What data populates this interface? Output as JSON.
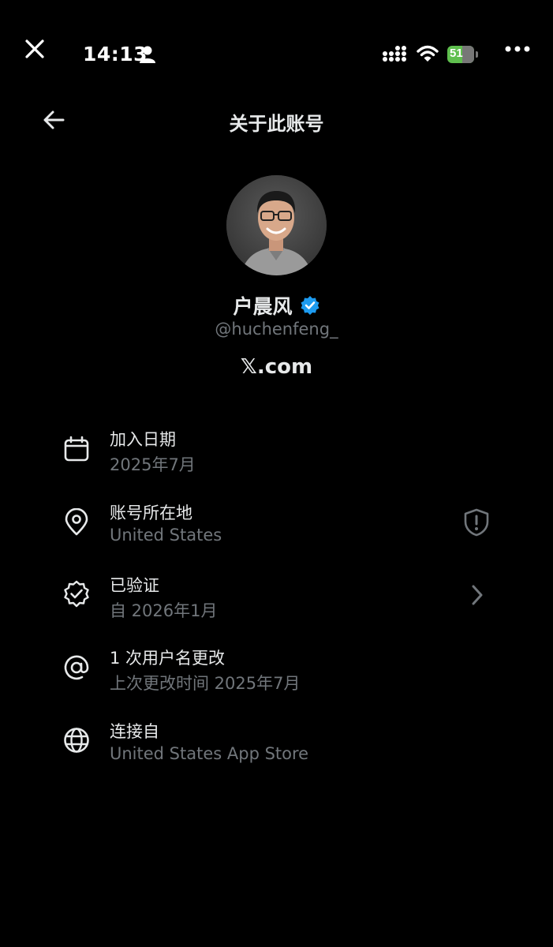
{
  "status_bar": {
    "time": "14:13",
    "battery": "51",
    "icons": [
      "close-icon",
      "person-icon",
      "signal-icon",
      "wifi-icon",
      "battery-icon",
      "more-icon"
    ]
  },
  "header": {
    "title": "关于此账号",
    "back_icon": "back-arrow-icon"
  },
  "profile": {
    "display_name": "户晨风",
    "handle": "@huchenfeng_",
    "source": "𝕏.com",
    "verified_color": "#1d9bf0"
  },
  "info_rows": [
    {
      "icon": "calendar-icon",
      "title": "加入日期",
      "subtitle": "2025年7月"
    },
    {
      "icon": "location-pin-icon",
      "title": "账号所在地",
      "subtitle": "United States",
      "trailing": "shield-alert-icon"
    },
    {
      "icon": "verified-badge-icon",
      "title": "已验证",
      "subtitle": "自 2026年1月",
      "trailing": "chevron-right-icon"
    },
    {
      "icon": "at-sign-icon",
      "title": "1 次用户名更改",
      "subtitle": "上次更改时间 2025年7月"
    },
    {
      "icon": "globe-icon",
      "title": "连接自",
      "subtitle": "United States App Store"
    }
  ],
  "colors": {
    "background": "#000000",
    "primary_text": "#e7e9ea",
    "secondary_text": "#71767b",
    "accent": "#1d9bf0"
  }
}
